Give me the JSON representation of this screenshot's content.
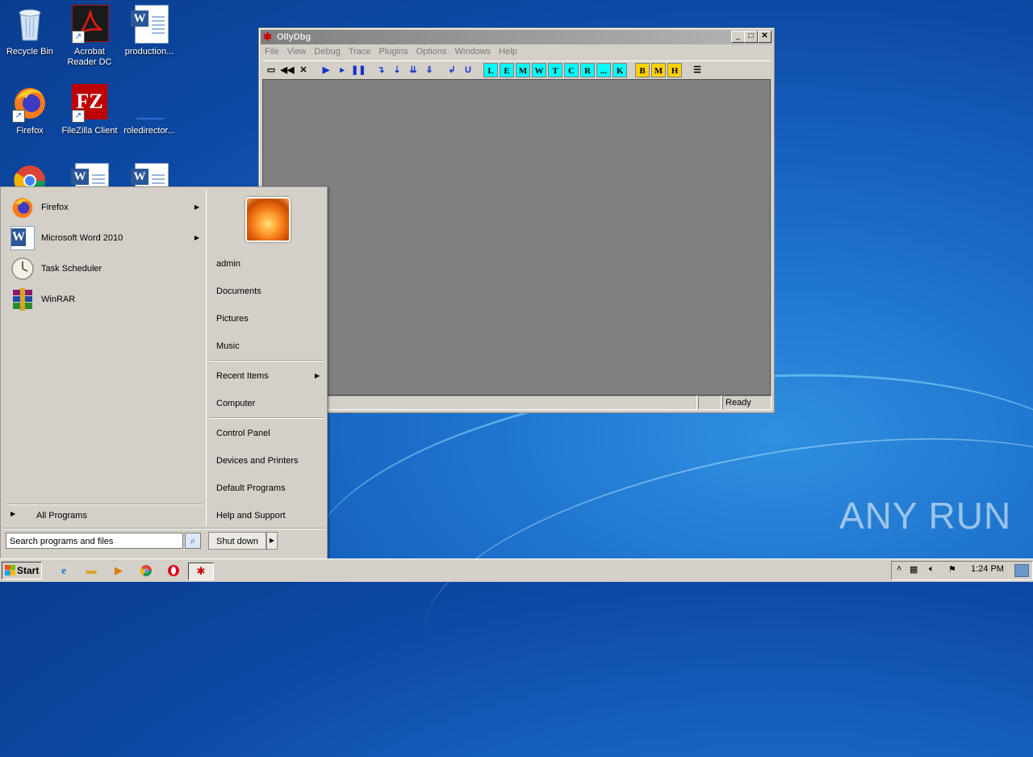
{
  "desktop": {
    "icons": [
      {
        "label": "Recycle Bin"
      },
      {
        "label": "Acrobat Reader DC"
      },
      {
        "label": "production..."
      },
      {
        "label": "Firefox"
      },
      {
        "label": "FileZilla Client"
      },
      {
        "label": "roledirector..."
      }
    ],
    "watermark": "ANY RUN"
  },
  "ollydbg": {
    "title": "OllyDbg",
    "menu": [
      "File",
      "View",
      "Debug",
      "Trace",
      "Plugins",
      "Options",
      "Windows",
      "Help"
    ],
    "toolbar_letters": [
      "L",
      "E",
      "M",
      "W",
      "T",
      "C",
      "R",
      "...",
      "K"
    ],
    "toolbar_yellow": [
      "B",
      "M",
      "H"
    ],
    "status": "Ready"
  },
  "start_menu": {
    "programs": [
      {
        "label": "Firefox",
        "submenu": true,
        "icon": "firefox-icon"
      },
      {
        "label": "Microsoft Word 2010",
        "submenu": true,
        "icon": "word-icon"
      },
      {
        "label": "Task Scheduler",
        "submenu": false,
        "icon": "clock-icon"
      },
      {
        "label": "WinRAR",
        "submenu": false,
        "icon": "winrar-icon"
      }
    ],
    "all_programs": "All Programs",
    "search_placeholder": "Search programs and files",
    "right_links": {
      "admin": "admin",
      "documents": "Documents",
      "pictures": "Pictures",
      "music": "Music",
      "recent": "Recent Items",
      "computer": "Computer",
      "control_panel": "Control Panel",
      "devices": "Devices and Printers",
      "defaults": "Default Programs",
      "help": "Help and Support"
    },
    "shutdown": "Shut down"
  },
  "taskbar": {
    "start": "Start",
    "clock": "1:24 PM"
  }
}
